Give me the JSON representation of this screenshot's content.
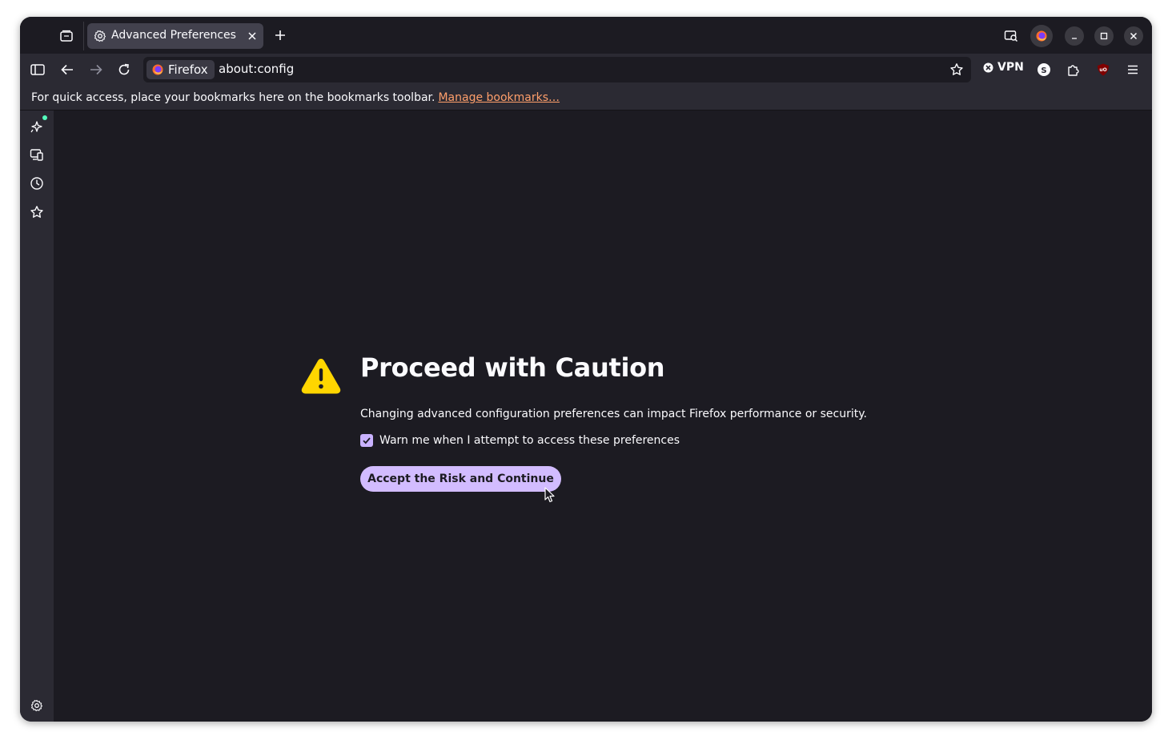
{
  "tab": {
    "title": "Advanced Preferences"
  },
  "urlbar": {
    "identity_label": "Firefox",
    "url": "about:config"
  },
  "toolbar": {
    "vpn_label": "VPN"
  },
  "bookmarks_bar": {
    "message": "For quick access, place your bookmarks here on the bookmarks toolbar.",
    "link_label": "Manage bookmarks…"
  },
  "page": {
    "title": "Proceed with Caution",
    "description": "Changing advanced configuration preferences can impact Firefox performance or security.",
    "checkbox_label": "Warn me when I attempt to access these preferences",
    "checkbox_checked": true,
    "accept_button": "Accept the Risk and Continue"
  },
  "icons": {
    "tab_strip": [
      "tab-list-icon",
      "settings-gear-icon",
      "close-icon",
      "plus-icon"
    ],
    "window": [
      "screenshot-search-icon",
      "firefox-account-icon",
      "minimize-icon",
      "maximize-icon",
      "close-window-icon"
    ],
    "navbar": [
      "sidebar-toggle-icon",
      "back-icon",
      "forward-icon",
      "reload-icon",
      "firefox-logo-icon",
      "bookmark-star-icon",
      "vpn-icon",
      "s-extension-icon",
      "extensions-puzzle-icon",
      "ublock-icon",
      "hamburger-menu-icon"
    ],
    "sidebar": [
      "ai-chatbot-icon",
      "synced-tabs-icon",
      "history-icon",
      "bookmarks-icon",
      "customize-sidebar-icon"
    ],
    "content": [
      "warning-icon",
      "checkmark-icon",
      "mouse-cursor-icon"
    ]
  },
  "colors": {
    "accent": "#d2bcff",
    "link": "#ff9f6b",
    "warning": "#ffd600",
    "background": "#1c1b22"
  }
}
